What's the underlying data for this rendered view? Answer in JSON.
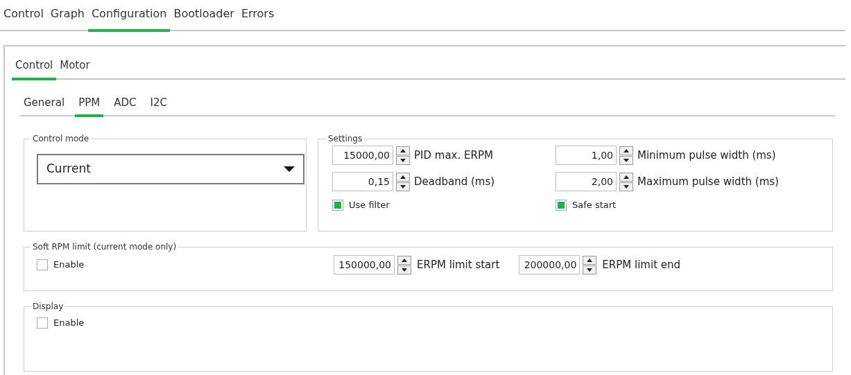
{
  "main_tabs": [
    {
      "label": "Control",
      "selected": false
    },
    {
      "label": "Graph",
      "selected": false
    },
    {
      "label": "Configuration",
      "selected": true
    },
    {
      "label": "Bootloader",
      "selected": false
    },
    {
      "label": "Errors",
      "selected": false
    }
  ],
  "config_tabs": [
    {
      "label": "Control",
      "selected": true
    },
    {
      "label": "Motor",
      "selected": false
    }
  ],
  "control_tabs": [
    {
      "label": "General",
      "selected": false
    },
    {
      "label": "PPM",
      "selected": true
    },
    {
      "label": "ADC",
      "selected": false
    },
    {
      "label": "I2C",
      "selected": false
    }
  ],
  "control_mode": {
    "title": "Control mode",
    "value": "Current"
  },
  "settings": {
    "title": "Settings",
    "fields": [
      {
        "value": "15000,00",
        "label": "PID max. ERPM"
      },
      {
        "value": "1,00",
        "label": "Minimum pulse width (ms)"
      },
      {
        "value": "0,15",
        "label": "Deadband (ms)"
      },
      {
        "value": "2,00",
        "label": "Maximum pulse width (ms)"
      }
    ],
    "checkboxes": [
      {
        "label": "Use filter",
        "checked": true
      },
      {
        "label": "Safe start",
        "checked": true
      }
    ]
  },
  "soft_rpm_limit": {
    "title": "Soft RPM limit (current mode only)",
    "enable": {
      "label": "Enable",
      "checked": false
    },
    "fields": [
      {
        "value": "150000,00",
        "label": "ERPM limit start"
      },
      {
        "value": "200000,00",
        "label": "ERPM limit end"
      }
    ]
  },
  "display": {
    "title": "Display",
    "enable": {
      "label": "Enable",
      "checked": false
    }
  }
}
